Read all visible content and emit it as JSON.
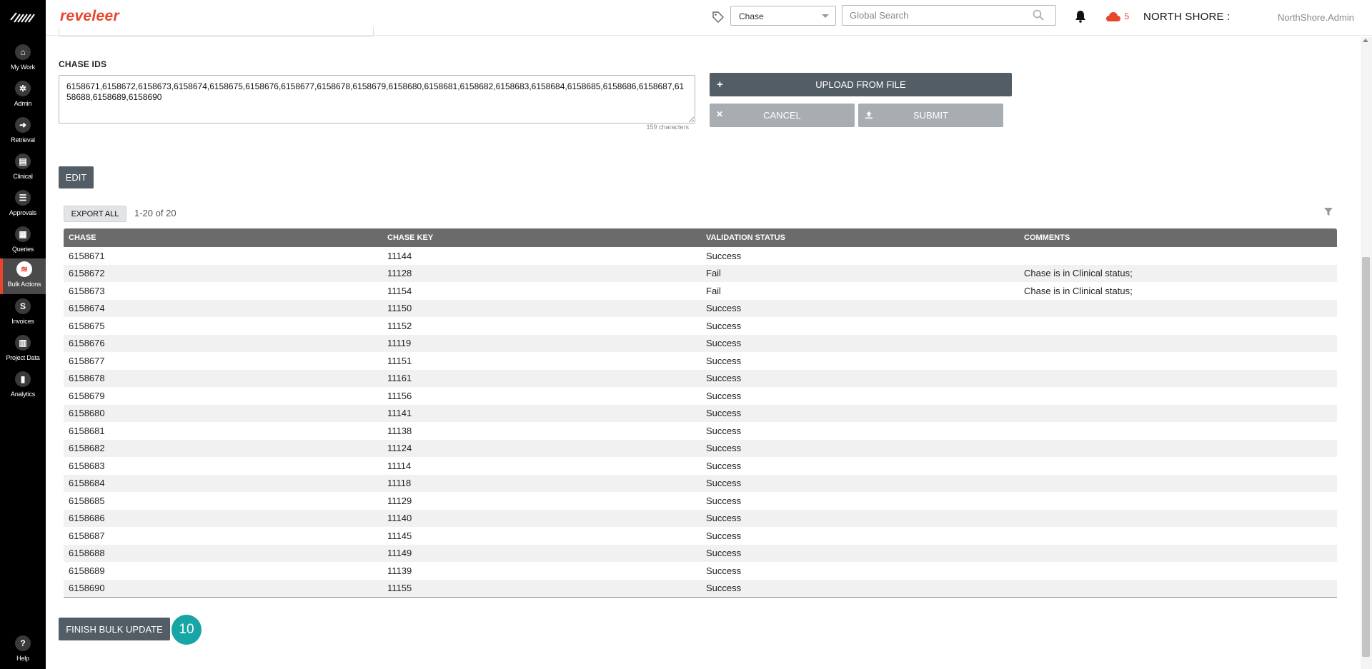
{
  "colors": {
    "brand": "#e8452c",
    "primary_button": "#525d66",
    "disabled_button": "#a8adb1",
    "badge": "#17a5a5"
  },
  "brand": {
    "name": "reveleer"
  },
  "leftnav": {
    "items": [
      {
        "label": "My Work",
        "icon": "home-icon"
      },
      {
        "label": "Admin",
        "icon": "gear-icon"
      },
      {
        "label": "Retrieval",
        "icon": "arrow-right-icon"
      },
      {
        "label": "Clinical",
        "icon": "clipboard-icon"
      },
      {
        "label": "Approvals",
        "icon": "list-icon"
      },
      {
        "label": "Queries",
        "icon": "document-icon"
      },
      {
        "label": "Bulk Actions",
        "icon": "layers-icon"
      },
      {
        "label": "Invoices",
        "icon": "dollar-icon"
      },
      {
        "label": "Project Data",
        "icon": "grid-icon"
      },
      {
        "label": "Analytics",
        "icon": "bar-chart-icon"
      }
    ],
    "help": {
      "label": "Help",
      "icon": "question-icon"
    }
  },
  "header": {
    "search_type": "Chase",
    "search_placeholder": "Global Search",
    "cloud_count": "5",
    "org": "NORTH SHORE :",
    "user": "NorthShore.Admin"
  },
  "form": {
    "chase_ids_label": "CHASE IDS",
    "chase_ids_value": "6158671,6158672,6158673,6158674,6158675,6158676,6158677,6158678,6158679,6158680,6158681,6158682,6158683,6158684,6158685,6158686,6158687,6158688,6158689,6158690",
    "char_count": "159 characters",
    "upload_label": "UPLOAD FROM FILE",
    "cancel_label": "CANCEL",
    "submit_label": "SUBMIT",
    "edit_label": "EDIT"
  },
  "grid": {
    "export_label": "EXPORT ALL",
    "pager": "1-20  of  20",
    "columns": [
      "CHASE",
      "CHASE KEY",
      "VALIDATION STATUS",
      "COMMENTS"
    ],
    "rows": [
      [
        "6158671",
        "11144",
        "Success",
        ""
      ],
      [
        "6158672",
        "11128",
        "Fail",
        "Chase is in Clinical status;"
      ],
      [
        "6158673",
        "11154",
        "Fail",
        "Chase is in Clinical status;"
      ],
      [
        "6158674",
        "11150",
        "Success",
        ""
      ],
      [
        "6158675",
        "11152",
        "Success",
        ""
      ],
      [
        "6158676",
        "11119",
        "Success",
        ""
      ],
      [
        "6158677",
        "11151",
        "Success",
        ""
      ],
      [
        "6158678",
        "11161",
        "Success",
        ""
      ],
      [
        "6158679",
        "11156",
        "Success",
        ""
      ],
      [
        "6158680",
        "11141",
        "Success",
        ""
      ],
      [
        "6158681",
        "11138",
        "Success",
        ""
      ],
      [
        "6158682",
        "11124",
        "Success",
        ""
      ],
      [
        "6158683",
        "11114",
        "Success",
        ""
      ],
      [
        "6158684",
        "11118",
        "Success",
        ""
      ],
      [
        "6158685",
        "11129",
        "Success",
        ""
      ],
      [
        "6158686",
        "11140",
        "Success",
        ""
      ],
      [
        "6158687",
        "11145",
        "Success",
        ""
      ],
      [
        "6158688",
        "11149",
        "Success",
        ""
      ],
      [
        "6158689",
        "11139",
        "Success",
        ""
      ],
      [
        "6158690",
        "11155",
        "Success",
        ""
      ]
    ]
  },
  "finish": {
    "label": "FINISH BULK UPDATE",
    "step": "10"
  }
}
